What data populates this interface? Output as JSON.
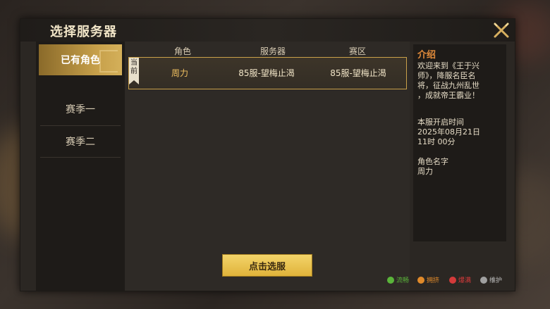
{
  "dialog": {
    "title": "选择服务器"
  },
  "sidebar": {
    "items": [
      {
        "label": "已有角色"
      },
      {
        "label": "赛季一"
      },
      {
        "label": "赛季二"
      }
    ]
  },
  "table": {
    "columns": [
      "角色",
      "服务器",
      "赛区"
    ],
    "rows": [
      {
        "tag": "当前",
        "role": "周力",
        "server": "85服-望梅止渴",
        "zone": "85服-望梅止渴"
      }
    ]
  },
  "select_button": {
    "label": "点击选服"
  },
  "info": {
    "title": "介绍",
    "intro_lines": [
      "欢迎来到《王于兴",
      "师》，降服名臣名",
      "将，征战九州乱世",
      "，成就帝王霸业！"
    ],
    "open_time_label": "本服开启时间",
    "open_date": "2025年08月21日",
    "open_clock": "11时 00分",
    "role_name_label": "角色名字",
    "role_name": "周力"
  },
  "legend": [
    {
      "label": "流畅",
      "color": "#5ab43a"
    },
    {
      "label": "拥挤",
      "color": "#e08a2a"
    },
    {
      "label": "爆满",
      "color": "#d43a3a"
    },
    {
      "label": "维护",
      "color": "#a0a0a0"
    }
  ],
  "colors": {
    "accent_gold": "#c9a04a",
    "button_gold": "#e8c050",
    "title_orange": "#e08a3a"
  }
}
